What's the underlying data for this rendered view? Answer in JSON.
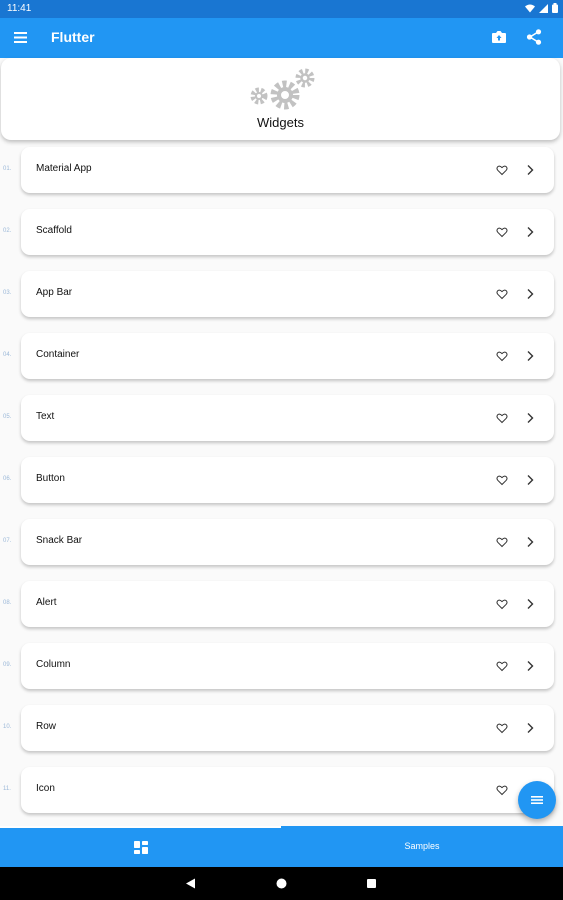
{
  "status_bar": {
    "time": "11:41",
    "icons": [
      "wifi-icon",
      "signal-icon",
      "battery-icon"
    ]
  },
  "app_bar": {
    "title": "Flutter",
    "menu_icon": "menu-icon",
    "actions": [
      "camera-upload-icon",
      "share-icon"
    ]
  },
  "header": {
    "title": "Widgets",
    "icon": "gears-icon"
  },
  "widgets": [
    {
      "number": "01.",
      "label": "Material App"
    },
    {
      "number": "02.",
      "label": "Scaffold"
    },
    {
      "number": "03.",
      "label": "App Bar"
    },
    {
      "number": "04.",
      "label": "Container"
    },
    {
      "number": "05.",
      "label": "Text"
    },
    {
      "number": "06.",
      "label": "Button"
    },
    {
      "number": "07.",
      "label": "Snack Bar"
    },
    {
      "number": "08.",
      "label": "Alert"
    },
    {
      "number": "09.",
      "label": "Column"
    },
    {
      "number": "10.",
      "label": "Row"
    },
    {
      "number": "11.",
      "label": "Icon"
    }
  ],
  "bottom_nav": {
    "tabs": [
      {
        "icon": "dashboard-icon",
        "label": ""
      },
      {
        "label": "Samples"
      }
    ],
    "selected": 0
  },
  "fab": {
    "icon": "list-icon"
  },
  "colors": {
    "primary": "#2196f3",
    "status_bar": "#1976d2",
    "number_text": "#9bb8d8"
  }
}
